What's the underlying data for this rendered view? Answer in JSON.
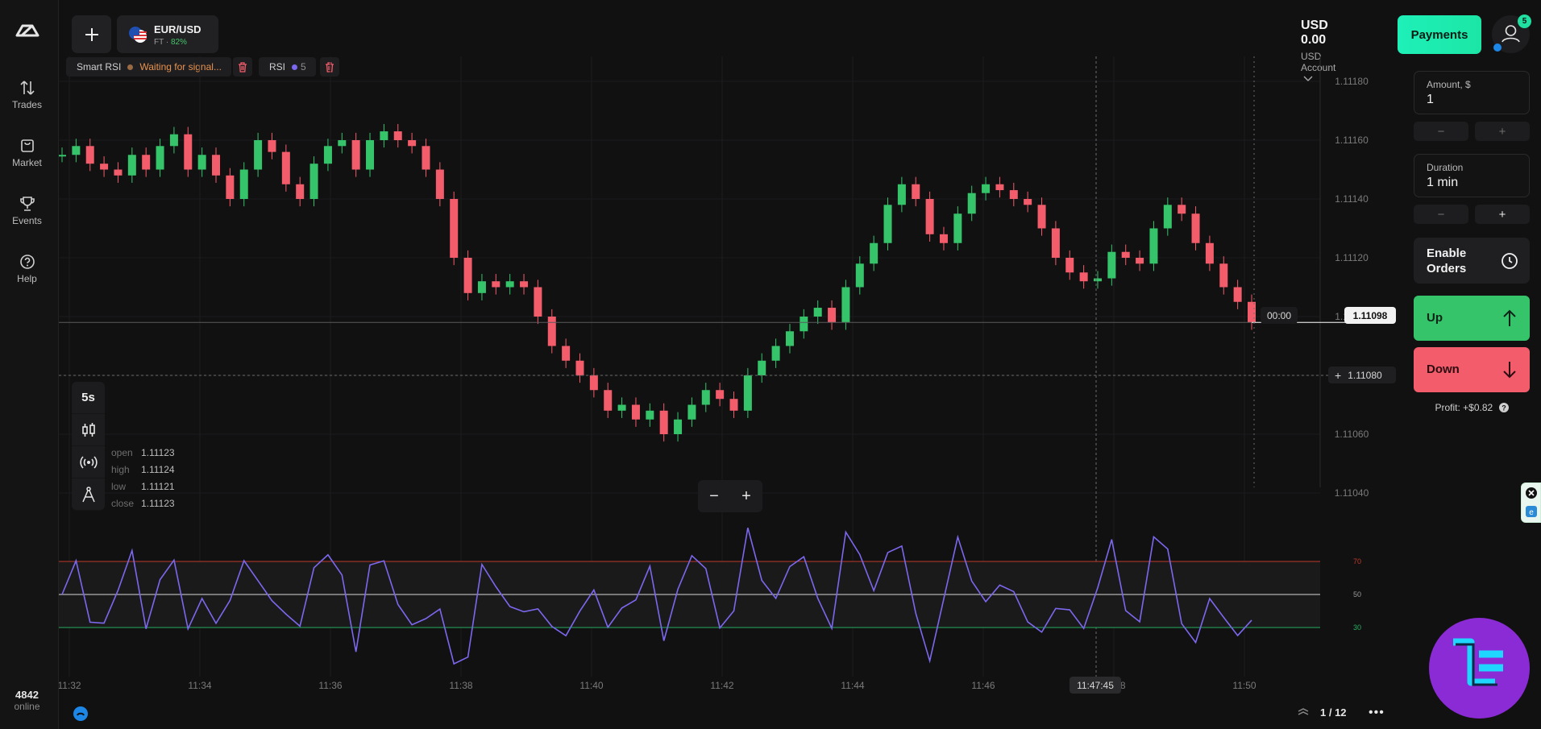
{
  "sidebar": {
    "items": [
      {
        "label": "Trades",
        "icon": "arrows-updown-icon"
      },
      {
        "label": "Market",
        "icon": "bag-icon"
      },
      {
        "label": "Events",
        "icon": "trophy-icon"
      },
      {
        "label": "Help",
        "icon": "help-circle-icon"
      }
    ],
    "online_count": "4842",
    "online_label": "online"
  },
  "asset": {
    "name": "EUR/USD",
    "type": "FT",
    "payout": "82%"
  },
  "indicators": [
    {
      "name": "Smart RSI",
      "status": "Waiting for signal...",
      "dot_color": "#9a6a44"
    },
    {
      "name": "RSI",
      "period": "5",
      "dot_color": "#7b68ee"
    }
  ],
  "account": {
    "balance": "USD 0.00",
    "account_name": "USD Account",
    "payments_label": "Payments",
    "notifications": "5"
  },
  "trade_panel": {
    "amount_label": "Amount, $",
    "amount_value": "1",
    "duration_label": "Duration",
    "duration_value": "1 min",
    "enable_orders_line1": "Enable",
    "enable_orders_line2": "Orders",
    "up_label": "Up",
    "down_label": "Down",
    "profit_text": "Profit: +$0.82"
  },
  "chart": {
    "timeframe": "5s",
    "price_levels": [
      "1.11180",
      "1.11160",
      "1.11140",
      "1.11120",
      "1.11100",
      "1.11080",
      "1.11060",
      "1.11040"
    ],
    "current_price": "1.11098",
    "countdown": "00:00",
    "crosshair_price": "1.11080",
    "crosshair_time": "11:47:45",
    "time_labels": [
      "11:32",
      "11:34",
      "11:36",
      "11:38",
      "11:40",
      "11:42",
      "11:44",
      "11:46",
      "11:48",
      "11:50"
    ],
    "ohlc": {
      "open": "1.11123",
      "high": "1.11124",
      "low": "1.11121",
      "close": "1.11123"
    },
    "rsi_levels": [
      "70",
      "50",
      "30"
    ],
    "up_color": "#36c46b",
    "down_color": "#f35c6b",
    "rsi_color": "#7b68ee"
  },
  "chart_data": {
    "type": "candlestick",
    "close_approx": [
      1.11155,
      1.11158,
      1.11152,
      1.1115,
      1.11148,
      1.11155,
      1.1115,
      1.11158,
      1.11162,
      1.1115,
      1.11155,
      1.11148,
      1.1114,
      1.1115,
      1.1116,
      1.11156,
      1.11145,
      1.1114,
      1.11152,
      1.11158,
      1.1116,
      1.1115,
      1.1116,
      1.11163,
      1.1116,
      1.11158,
      1.1115,
      1.1114,
      1.1112,
      1.11108,
      1.11112,
      1.1111,
      1.11112,
      1.1111,
      1.111,
      1.1109,
      1.11085,
      1.1108,
      1.11075,
      1.11068,
      1.1107,
      1.11065,
      1.11068,
      1.1106,
      1.11065,
      1.1107,
      1.11075,
      1.11072,
      1.11068,
      1.1108,
      1.11085,
      1.1109,
      1.11095,
      1.111,
      1.11103,
      1.11098,
      1.1111,
      1.11118,
      1.11125,
      1.11138,
      1.11145,
      1.1114,
      1.11128,
      1.11125,
      1.11135,
      1.11142,
      1.11145,
      1.11143,
      1.1114,
      1.11138,
      1.1113,
      1.1112,
      1.11115,
      1.11112,
      1.11113,
      1.11122,
      1.1112,
      1.11118,
      1.1113,
      1.11138,
      1.11135,
      1.11125,
      1.11118,
      1.1111,
      1.11105,
      1.11098
    ],
    "rsi_levels": [
      70,
      50,
      30
    ]
  }
}
